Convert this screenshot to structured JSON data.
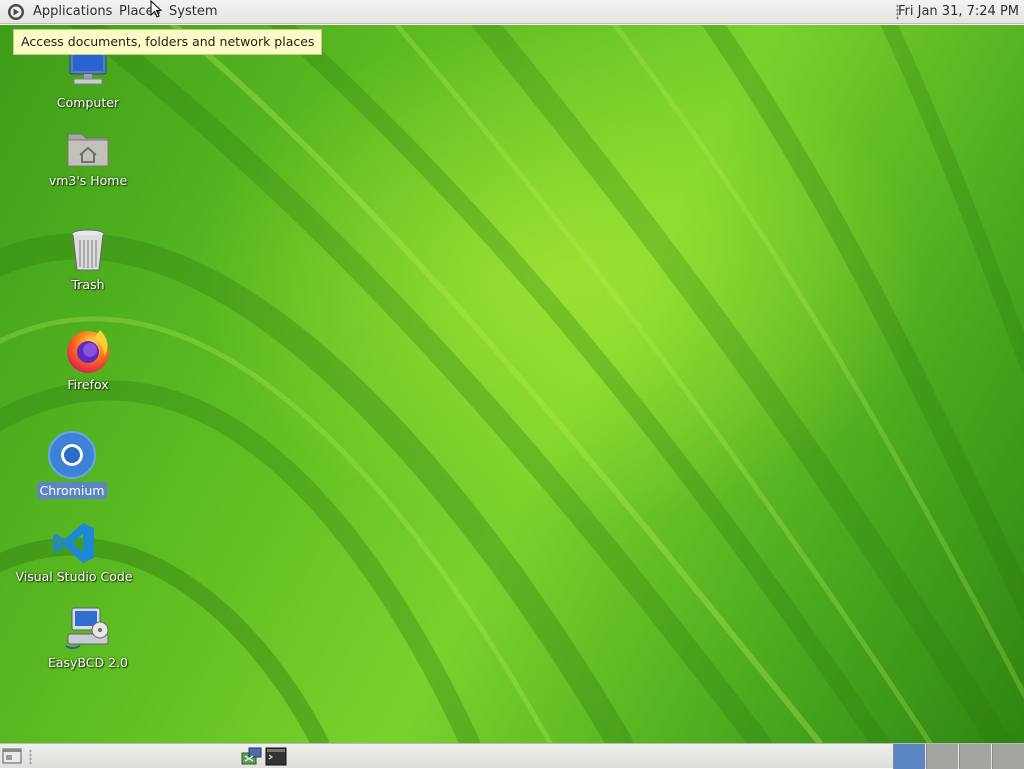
{
  "top_panel": {
    "menus": [
      "Applications",
      "Places",
      "System"
    ],
    "clock": "Fri Jan 31,  7:24 PM"
  },
  "tooltip": "Access documents, folders and network places",
  "desktop_icons": [
    {
      "label": "Computer",
      "icon": "computer-icon"
    },
    {
      "label": "vm3's Home",
      "icon": "home-folder-icon"
    },
    {
      "label": "Trash",
      "icon": "trash-icon"
    },
    {
      "label": "Firefox",
      "icon": "firefox-icon"
    },
    {
      "label": "Chromium",
      "icon": "chromium-icon",
      "selected": true
    },
    {
      "label": "Visual Studio Code",
      "icon": "vscode-icon"
    },
    {
      "label": "EasyBCD 2.0",
      "icon": "easybcd-icon"
    }
  ],
  "colors": {
    "panel": "#e8e8e5",
    "wallpaper": "#5cbb22",
    "selection": "#5b86c3",
    "tooltip": "#fbfbc5",
    "active_workspace": "#5b86c3"
  },
  "workspaces": {
    "count": 4,
    "active": 1
  }
}
